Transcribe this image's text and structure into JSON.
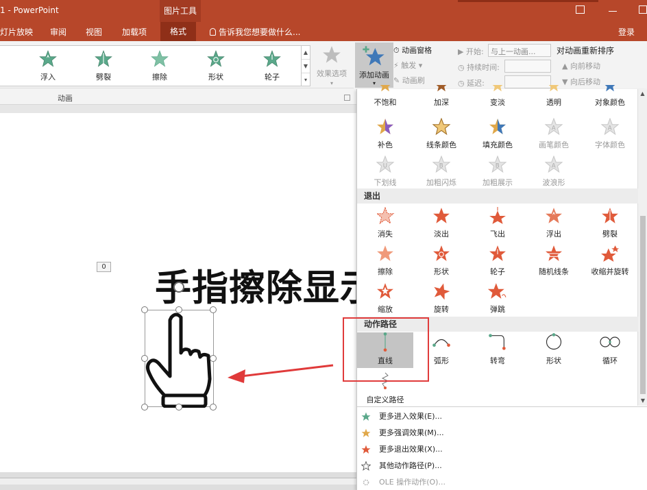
{
  "titlebar": {
    "title": "1 - PowerPoint",
    "context_tab": "图片工具",
    "color": "#b7472a"
  },
  "tabs": [
    {
      "label": "灯片放映"
    },
    {
      "label": "审阅"
    },
    {
      "label": "视图"
    },
    {
      "label": "加载项"
    },
    {
      "label": "格式"
    }
  ],
  "tellme": "告诉我您想要做什么...",
  "login": "登录",
  "ribbon": {
    "gallery": [
      {
        "label": "浮入",
        "color": "#5aa88a"
      },
      {
        "label": "劈裂",
        "color": "#5aa88a"
      },
      {
        "label": "擦除",
        "color": "#5aa88a"
      },
      {
        "label": "形状",
        "color": "#5aa88a"
      },
      {
        "label": "轮子",
        "color": "#5aa88a"
      }
    ],
    "effect_options": "效果选项",
    "group_label": "动画",
    "add_animation": "添加动画",
    "animation_pane": "动画窗格",
    "trigger": "触发",
    "animation_painter": "动画刷",
    "start_label": "开始:",
    "start_value": "与上一动画...",
    "duration_label": "持续时间:",
    "delay_label": "延迟:",
    "reorder_title": "对动画重新排序",
    "move_earlier": "向前移动",
    "move_later": "向后移动"
  },
  "slide": {
    "tag": "0",
    "text": "手指擦除显示"
  },
  "dropdown": {
    "emphasis_row1": [
      {
        "label": "不饱和",
        "color": "#e0a84a",
        "disabled": false
      },
      {
        "label": "加深",
        "color": "#e0a84a",
        "disabled": false
      },
      {
        "label": "变淡",
        "color": "#e0a84a",
        "disabled": false
      },
      {
        "label": "透明",
        "color": "#e0a84a",
        "disabled": false
      },
      {
        "label": "对象颜色",
        "color": "#e0a84a",
        "disabled": false
      }
    ],
    "emphasis_row2": [
      {
        "label": "补色",
        "color": "#8a5cc0",
        "disabled": false
      },
      {
        "label": "线条颜色",
        "color": "#e0a84a",
        "disabled": false
      },
      {
        "label": "填充颜色",
        "color": "#3f78b8",
        "disabled": false
      },
      {
        "label": "画笔颜色",
        "color": "#c8c8c8",
        "disabled": true
      },
      {
        "label": "字体颜色",
        "color": "#c8c8c8",
        "disabled": true
      }
    ],
    "emphasis_row3": [
      {
        "label": "下划线",
        "color": "#c8c8c8",
        "disabled": true
      },
      {
        "label": "加粗闪烁",
        "color": "#c8c8c8",
        "disabled": true
      },
      {
        "label": "加粗展示",
        "color": "#c8c8c8",
        "disabled": true
      },
      {
        "label": "波浪形",
        "color": "#c8c8c8",
        "disabled": true
      }
    ],
    "exit_title": "退出",
    "exit_row1": [
      {
        "label": "消失",
        "color": "#e05a3a"
      },
      {
        "label": "淡出",
        "color": "#e05a3a"
      },
      {
        "label": "飞出",
        "color": "#e05a3a"
      },
      {
        "label": "浮出",
        "color": "#e05a3a"
      },
      {
        "label": "劈裂",
        "color": "#e05a3a"
      }
    ],
    "exit_row2": [
      {
        "label": "擦除",
        "color": "#e05a3a"
      },
      {
        "label": "形状",
        "color": "#e05a3a"
      },
      {
        "label": "轮子",
        "color": "#e05a3a"
      },
      {
        "label": "随机线条",
        "color": "#e05a3a"
      },
      {
        "label": "收缩并旋转",
        "color": "#e05a3a"
      }
    ],
    "exit_row3": [
      {
        "label": "缩放",
        "color": "#e05a3a"
      },
      {
        "label": "旋转",
        "color": "#e05a3a"
      },
      {
        "label": "弹跳",
        "color": "#e05a3a"
      }
    ],
    "path_title": "动作路径",
    "paths": [
      {
        "label": "直线",
        "selected": true
      },
      {
        "label": "弧形",
        "selected": false
      },
      {
        "label": "转弯",
        "selected": false
      },
      {
        "label": "形状",
        "selected": false
      },
      {
        "label": "循环",
        "selected": false
      }
    ],
    "custom_path": "自定义路径",
    "menu": [
      {
        "label": "更多进入效果(E)...",
        "color": "#5aa88a",
        "disabled": false
      },
      {
        "label": "更多强调效果(M)...",
        "color": "#e0a84a",
        "disabled": false
      },
      {
        "label": "更多退出效果(X)...",
        "color": "#e05a3a",
        "disabled": false
      },
      {
        "label": "其他动作路径(P)...",
        "color": "#888888",
        "disabled": false
      },
      {
        "label": "OLE 操作动作(O)...",
        "color": "#c8c8c8",
        "disabled": true
      }
    ]
  }
}
